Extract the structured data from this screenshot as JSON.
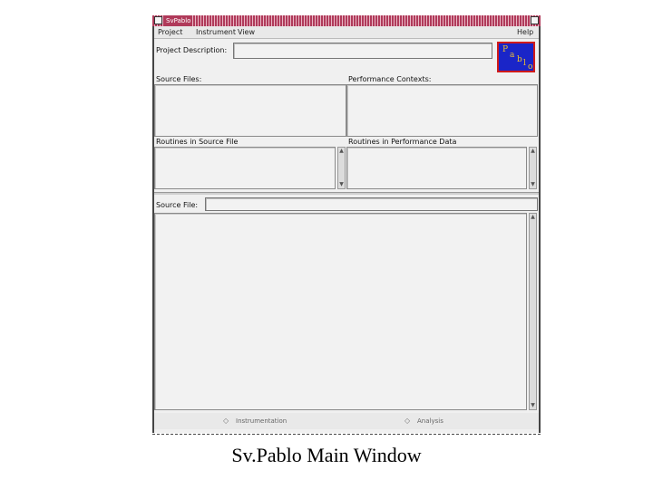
{
  "window": {
    "title": "SvPablo",
    "menus": [
      "Project",
      "Instrument",
      "View",
      "Help"
    ]
  },
  "project_description": {
    "label": "Project Description:",
    "value": ""
  },
  "logo": {
    "letters": [
      "P",
      "a",
      "b",
      "l",
      "o"
    ]
  },
  "panes": {
    "source_files": "Source Files:",
    "performance_contexts": "Performance Contexts:",
    "routines_in_source_file": "Routines in Source File",
    "routines_in_performance_data": "Routines in Performance Data"
  },
  "source_file": {
    "label": "Source File:",
    "value": ""
  },
  "radio_options": [
    "Instrumentation",
    "Analysis"
  ],
  "caption": "Sv.Pablo Main Window",
  "colors": {
    "titlebar": "#b03a5a",
    "logo_bg": "#1a25c8",
    "logo_border": "#d01a1a"
  }
}
